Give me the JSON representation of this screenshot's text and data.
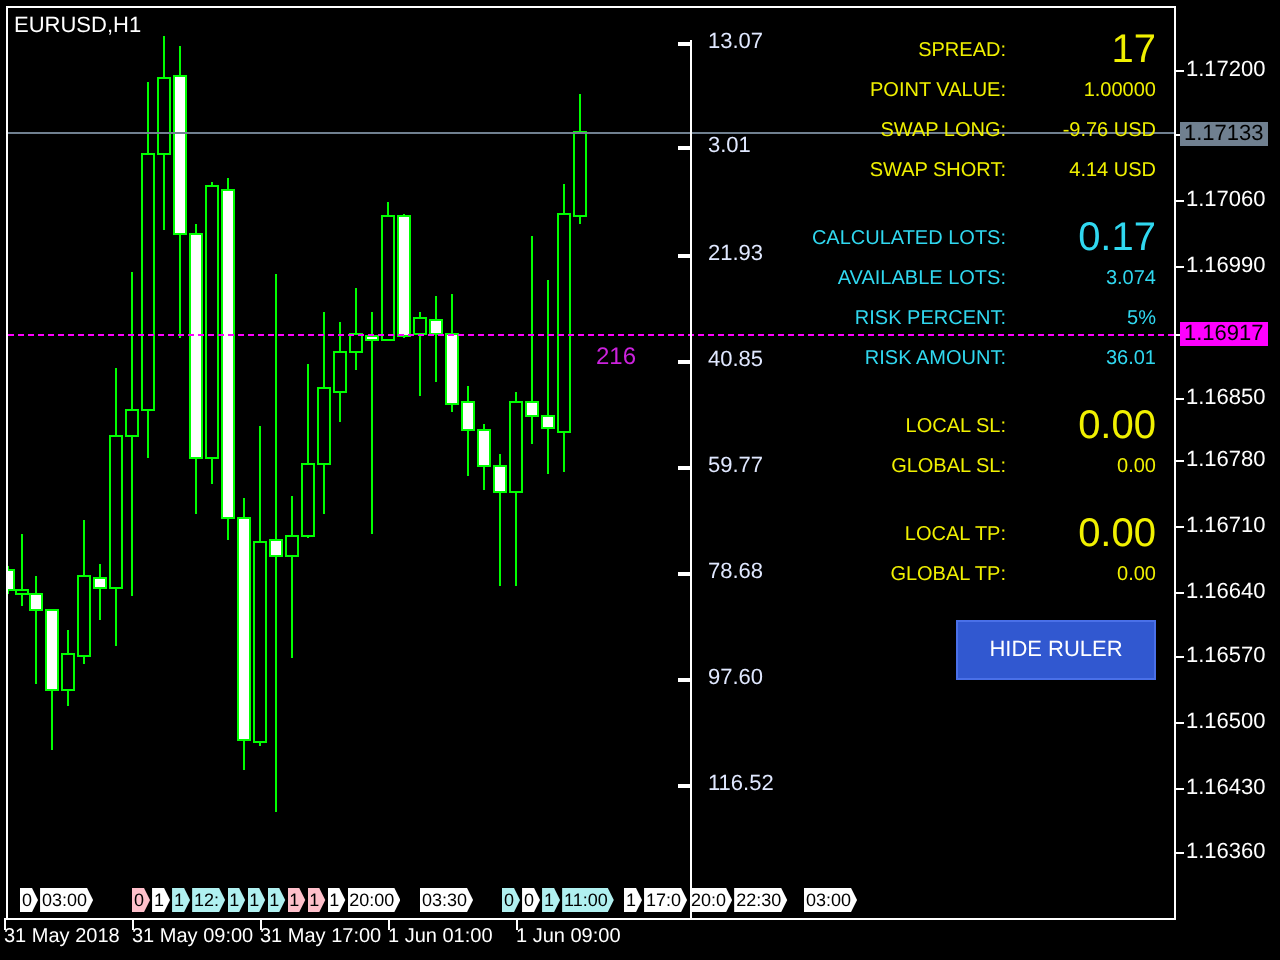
{
  "chart": {
    "title": "EURUSD,H1",
    "ruler_reading": "216"
  },
  "ruler_scale": [
    "13.07",
    "3.01",
    "21.93",
    "40.85",
    "59.77",
    "78.68",
    "97.60",
    "116.52"
  ],
  "info_panel": {
    "rows": [
      {
        "label": "SPREAD:",
        "value": "17",
        "kind": "large",
        "color": "#f0f000"
      },
      {
        "label": "POINT VALUE:",
        "value": "1.00000",
        "kind": "normal",
        "color": "#f0f000"
      },
      {
        "label": "SWAP LONG:",
        "value": "-9.76 USD",
        "kind": "normal",
        "color": "#f0f000"
      },
      {
        "label": "SWAP SHORT:",
        "value": "4.14 USD",
        "kind": "normal",
        "color": "#f0f000"
      },
      {
        "label": "CALCULATED LOTS:",
        "value": "0.17",
        "kind": "large",
        "color": "#30d8f0"
      },
      {
        "label": "AVAILABLE LOTS:",
        "value": "3.074",
        "kind": "normal",
        "color": "#30d8f0"
      },
      {
        "label": "RISK PERCENT:",
        "value": "5%",
        "kind": "normal",
        "color": "#30d8f0"
      },
      {
        "label": "RISK AMOUNT:",
        "value": "36.01",
        "kind": "normal",
        "color": "#30d8f0"
      },
      {
        "label": "LOCAL SL:",
        "value": "0.00",
        "kind": "large",
        "color": "#f0f000"
      },
      {
        "label": "GLOBAL SL:",
        "value": "0.00",
        "kind": "normal",
        "color": "#f0f000"
      },
      {
        "label": "LOCAL TP:",
        "value": "0.00",
        "kind": "large",
        "color": "#f0f000"
      },
      {
        "label": "GLOBAL TP:",
        "value": "0.00",
        "kind": "normal",
        "color": "#f0f000"
      }
    ],
    "button": "HIDE RULER"
  },
  "price_axis": [
    {
      "label": "1.17200",
      "kind": "tick"
    },
    {
      "label": "1.17133",
      "kind": "marker",
      "color": "#708090"
    },
    {
      "label": "1.17060",
      "kind": "tick"
    },
    {
      "label": "1.16990",
      "kind": "tick"
    },
    {
      "label": "1.16917",
      "kind": "marker",
      "color": "#ff00ff"
    },
    {
      "label": "1.16850",
      "kind": "tick"
    },
    {
      "label": "1.16780",
      "kind": "tick"
    },
    {
      "label": "1.16710",
      "kind": "tick"
    },
    {
      "label": "1.16640",
      "kind": "tick"
    },
    {
      "label": "1.16570",
      "kind": "tick"
    },
    {
      "label": "1.16500",
      "kind": "tick"
    },
    {
      "label": "1.16430",
      "kind": "tick"
    },
    {
      "label": "1.16360",
      "kind": "tick"
    }
  ],
  "time_tags": [
    {
      "label": "0",
      "color": "#ffffff"
    },
    {
      "label": "03:00",
      "color": "#ffffff"
    },
    {
      "label": "0",
      "color": "#ffc0cb"
    },
    {
      "label": "1",
      "color": "#ffffff"
    },
    {
      "label": "1",
      "color": "#b0f0f0"
    },
    {
      "label": "12:",
      "color": "#b0f0f0"
    },
    {
      "label": "1",
      "color": "#b0f0f0"
    },
    {
      "label": "1",
      "color": "#b0f0f0"
    },
    {
      "label": "1",
      "color": "#b0f0f0"
    },
    {
      "label": "1",
      "color": "#ffc0cb"
    },
    {
      "label": "1",
      "color": "#ffc0cb"
    },
    {
      "label": "1",
      "color": "#ffffff"
    },
    {
      "label": "20:00",
      "color": "#ffffff"
    },
    {
      "label": "03:30",
      "color": "#ffffff"
    },
    {
      "label": "0",
      "color": "#b0f0f0"
    },
    {
      "label": "0",
      "color": "#ffffff"
    },
    {
      "label": "1",
      "color": "#b0f0f0"
    },
    {
      "label": "11:00",
      "color": "#b0f0f0"
    },
    {
      "label": "1",
      "color": "#ffffff"
    },
    {
      "label": "17:0",
      "color": "#ffffff"
    },
    {
      "label": "20:0",
      "color": "#ffffff"
    },
    {
      "label": "22:30",
      "color": "#ffffff"
    },
    {
      "label": "03:00",
      "color": "#ffffff"
    }
  ],
  "time_axis": [
    "31 May 2018",
    "31 May 09:00",
    "31 May 17:00",
    "1 Jun 01:00",
    "1 Jun 09:00"
  ]
}
